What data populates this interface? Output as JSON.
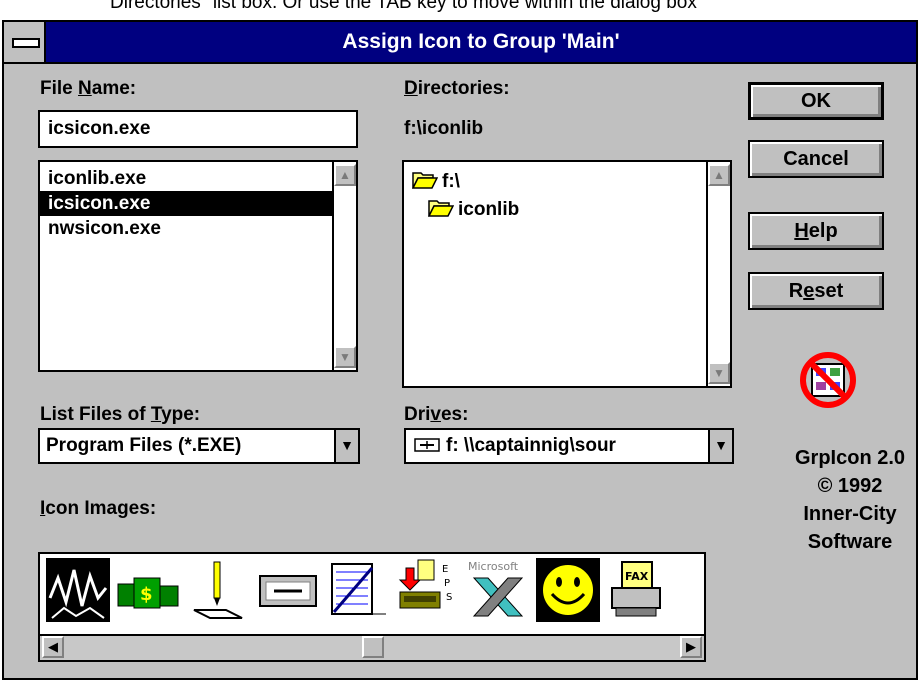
{
  "top_caption": "Directories\" list box. Or use the TAB key to move within the dialog box",
  "window": {
    "title": "Assign Icon to Group 'Main'"
  },
  "file_name": {
    "label_pre": "File ",
    "label_u": "N",
    "label_post": "ame:",
    "value": "icsicon.exe",
    "files": [
      "iconlib.exe",
      "icsicon.exe",
      "nwsicon.exe"
    ],
    "selected_index": 1
  },
  "directories": {
    "label_u": "D",
    "label_post": "irectories:",
    "current_path": "f:\\iconlib",
    "items": [
      "f:\\",
      "iconlib"
    ]
  },
  "file_type": {
    "label_pre": "List Files of ",
    "label_u": "T",
    "label_post": "ype:",
    "value": "Program Files (*.EXE)"
  },
  "drives": {
    "label_pre": "Dri",
    "label_u": "v",
    "label_post": "es:",
    "value": "f: \\\\captainnig\\sour"
  },
  "icon_images": {
    "label_u": "I",
    "label_post": "con Images:",
    "icons": [
      "network-icon",
      "money-icon",
      "pencil-icon",
      "cassette-icon",
      "notepad-icon",
      "eps-printer-icon",
      "microsoft-x-icon",
      "smiley-icon",
      "fax-icon"
    ]
  },
  "buttons": {
    "ok": "OK",
    "cancel": "Cancel",
    "help_u": "H",
    "help_post": "elp",
    "reset_pre": "R",
    "reset_u": "e",
    "reset_post": "set"
  },
  "credits": {
    "line1": "GrpIcon 2.0",
    "line2": "© 1992",
    "line3": "Inner-City",
    "line4": "Software"
  },
  "colors": {
    "title_bar": "#000080",
    "dialog_bg": "#c0c0c0",
    "selection": "#000000"
  }
}
